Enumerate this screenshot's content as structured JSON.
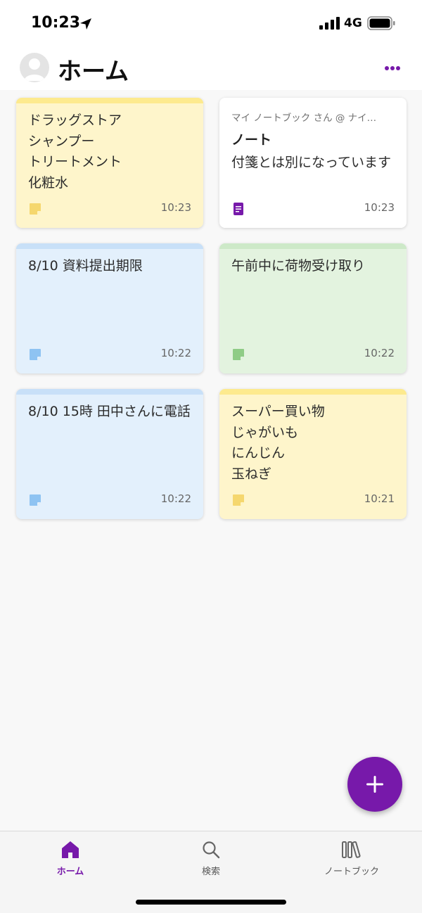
{
  "status_bar": {
    "time": "10:23",
    "network": "4G"
  },
  "header": {
    "title": "ホーム",
    "avatar": "person-icon",
    "more": "more-icon"
  },
  "colors": {
    "accent": "#7719aa",
    "yellow": "#fef5cb",
    "blue": "#e3f0fc",
    "green": "#e3f3df"
  },
  "cards": [
    {
      "text": "ドラッグストア\nシャンプー\nトリートメント\n化粧水",
      "time": "10:23",
      "color": "yellow"
    },
    {
      "notebook": "マイ ノートブック さん @ ナイ…",
      "title": "ノート",
      "text": "付箋とは別になっています",
      "time": "10:23",
      "color": "white"
    },
    {
      "text": "8/10 資料提出期限",
      "time": "10:22",
      "color": "blue"
    },
    {
      "text": "午前中に荷物受け取り",
      "time": "10:22",
      "color": "green"
    },
    {
      "text": "8/10 15時 田中さんに電話",
      "time": "10:22",
      "color": "blue"
    },
    {
      "text": "スーパー買い物\nじゃがいも\nにんじん\n玉ねぎ",
      "time": "10:21",
      "color": "yellow"
    }
  ],
  "fab": {
    "icon": "plus-icon"
  },
  "tabs": [
    {
      "label": "ホーム",
      "icon": "home-icon",
      "active": true
    },
    {
      "label": "検索",
      "icon": "search-icon",
      "active": false
    },
    {
      "label": "ノートブック",
      "icon": "notebooks-icon",
      "active": false
    }
  ]
}
